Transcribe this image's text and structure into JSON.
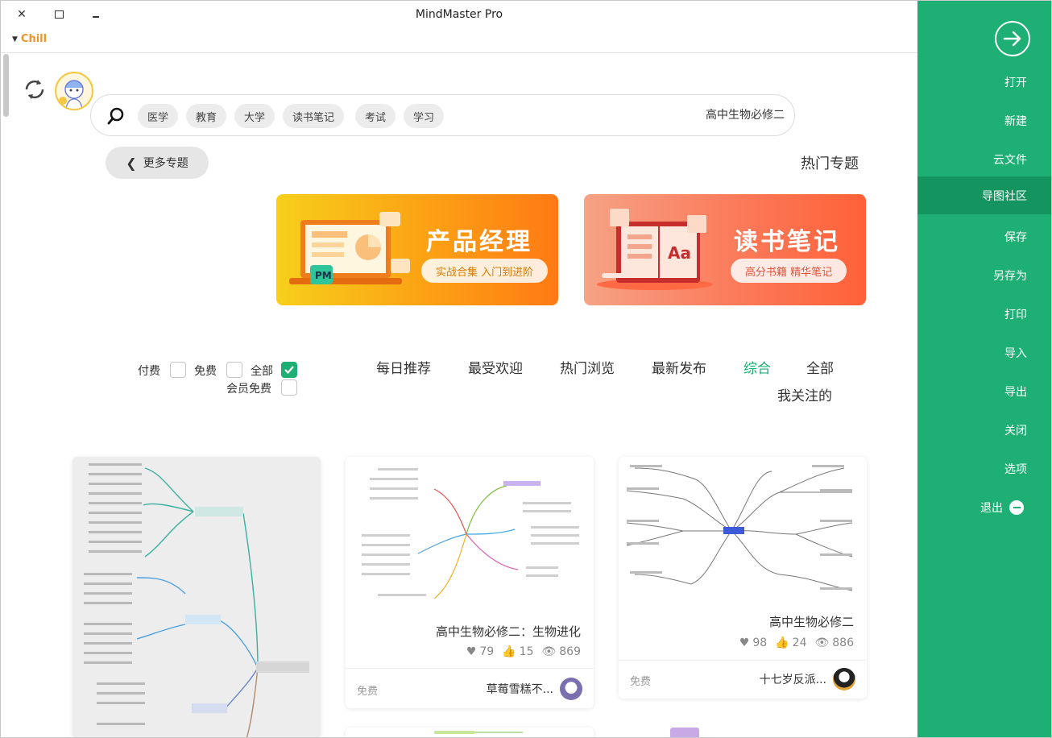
{
  "window": {
    "title": "MindMaster Pro",
    "brand": "Chill"
  },
  "sidebar": {
    "items": [
      {
        "label": "打开"
      },
      {
        "label": "新建"
      },
      {
        "label": "云文件"
      },
      {
        "label": "导图社区",
        "active": true
      },
      {
        "label": "保存"
      },
      {
        "label": "另存为"
      },
      {
        "label": "打印"
      },
      {
        "label": "导入"
      },
      {
        "label": "导出"
      },
      {
        "label": "关闭"
      },
      {
        "label": "选项"
      },
      {
        "label": "退出",
        "icon": "minus-circle-icon"
      }
    ]
  },
  "search": {
    "value": "高中生物必修二",
    "tags": [
      "学习",
      "考试",
      "读书笔记",
      "大学",
      "教育",
      "医学"
    ]
  },
  "hot_topics": {
    "title": "热门专题",
    "more_label": "更多专题",
    "banners": [
      {
        "title": "产品经理",
        "subtitle": "实战合集 入门到进阶",
        "badge": "PM"
      },
      {
        "title": "读书笔记",
        "subtitle": "高分书籍 精华笔记",
        "badge": "Aa"
      }
    ]
  },
  "filters": {
    "tabs": [
      "全部",
      "综合",
      "最新发布",
      "热门浏览",
      "最受欢迎",
      "每日推荐",
      "我关注的"
    ],
    "active_tab": "综合",
    "checkboxes": [
      {
        "label": "全部",
        "checked": true
      },
      {
        "label": "免费",
        "checked": false
      },
      {
        "label": "付费",
        "checked": false
      },
      {
        "label": "会员免费",
        "checked": false
      }
    ]
  },
  "cards": [
    {
      "title": "高中生物必修二",
      "views": "886",
      "likes": "24",
      "favs": "98",
      "author": "十七岁反派...",
      "price": "免费"
    },
    {
      "title": "高中生物必修二：生物进化",
      "views": "869",
      "likes": "15",
      "favs": "79",
      "author": "草莓雪糕不...",
      "price": "免费"
    },
    {
      "title": "",
      "views": "",
      "likes": "",
      "favs": "",
      "author": "",
      "price": ""
    }
  ],
  "colors": {
    "accent": "#1daf74",
    "sidebar": "#1daf74",
    "brand": "#f0932b"
  }
}
